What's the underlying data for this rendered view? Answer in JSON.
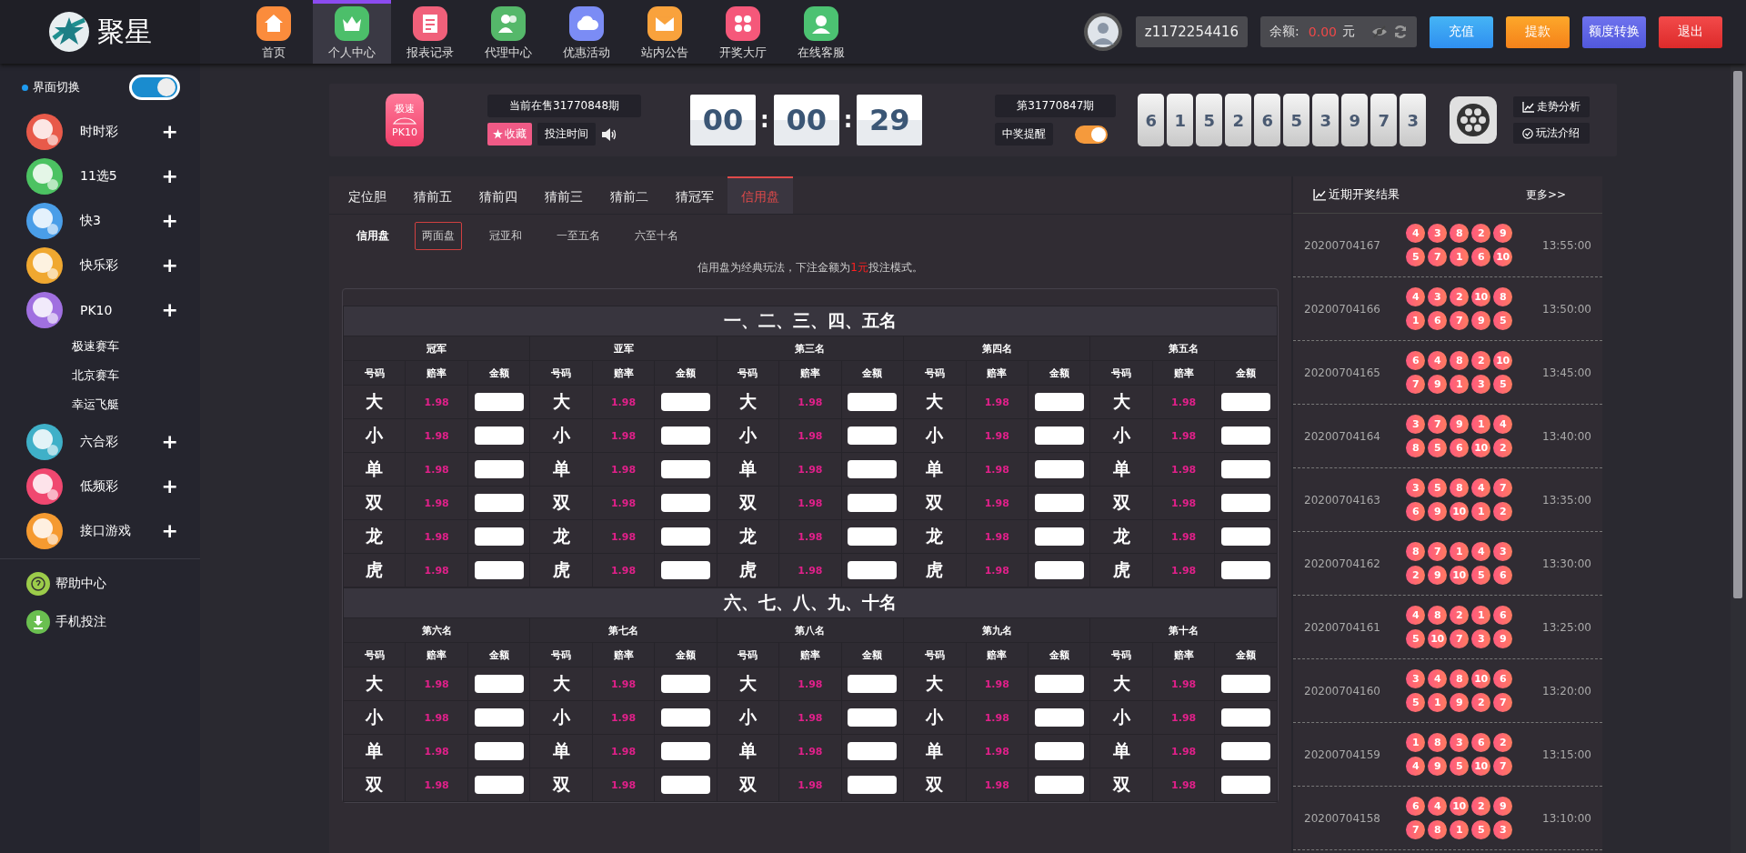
{
  "brand": {
    "name": "聚星"
  },
  "nav": [
    {
      "label": "首页",
      "kind": "home",
      "color": "#fb8c3c",
      "selected": false
    },
    {
      "label": "个人中心",
      "kind": "crown",
      "color": "#4cbf6a",
      "selected": true
    },
    {
      "label": "报表记录",
      "kind": "doc",
      "color": "#f0607a",
      "selected": false
    },
    {
      "label": "代理中心",
      "kind": "people",
      "color": "#55b86a",
      "selected": false
    },
    {
      "label": "优惠活动",
      "kind": "cloud",
      "color": "#7b8cf5",
      "selected": false
    },
    {
      "label": "站内公告",
      "kind": "mail",
      "color": "#f9a23c",
      "selected": false
    },
    {
      "label": "开奖大厅",
      "kind": "grid",
      "color": "#f5587a",
      "selected": false
    },
    {
      "label": "在线客服",
      "kind": "support",
      "color": "#4cc272",
      "selected": false
    }
  ],
  "user": {
    "username": "z1172254416",
    "balance_label": "余额:",
    "balance": "0.00",
    "currency": "元"
  },
  "actions": [
    {
      "label": "充值",
      "kind": "blue"
    },
    {
      "label": "提款",
      "kind": "orange"
    },
    {
      "label": "额度转换",
      "kind": "purple"
    },
    {
      "label": "退出",
      "kind": "red"
    }
  ],
  "sidebar": {
    "switch": {
      "label": "界面切换",
      "on": true
    },
    "categories": [
      {
        "label": "时时彩",
        "color": "#e85a4a",
        "sign": "+"
      },
      {
        "label": "11选5",
        "color": "#4cc262",
        "sign": "+"
      },
      {
        "label": "快3",
        "color": "#4a9ee8",
        "sign": "+"
      },
      {
        "label": "快乐彩",
        "color": "#f0a830",
        "sign": "+"
      },
      {
        "label": "PK10",
        "color": "#a070e0",
        "sign": "+",
        "children": [
          {
            "label": "极速赛车"
          },
          {
            "label": "北京赛车"
          },
          {
            "label": "幸运飞艇"
          }
        ]
      },
      {
        "label": "六合彩",
        "color": "#3fb0c8",
        "sign": "+"
      },
      {
        "label": "低频彩",
        "color": "#f04870",
        "sign": "+"
      },
      {
        "label": "接口游戏",
        "color": "#f59a30",
        "sign": "+"
      }
    ],
    "links": [
      {
        "label": "帮助中心",
        "kind": "help"
      },
      {
        "label": "手机投注",
        "kind": "download"
      }
    ]
  },
  "game": {
    "logo_top": "极速",
    "logo_bottom": "PK10",
    "current_issue": "当前在售31770848期",
    "favorite": "收藏",
    "bet_time": "投注时间",
    "timer": [
      "00",
      "00",
      "29"
    ],
    "separator": ":",
    "last_issue": "第31770847期",
    "win_alert": {
      "label": "中奖提醒",
      "on": true
    },
    "numbers": [
      "6",
      "1",
      "5",
      "2",
      "6",
      "5",
      "3",
      "9",
      "7",
      "3"
    ],
    "links": [
      "走势分析",
      "玩法介绍"
    ]
  },
  "tabs": [
    {
      "label": "定位胆",
      "selected": false
    },
    {
      "label": "猜前五",
      "selected": false
    },
    {
      "label": "猜前四",
      "selected": false
    },
    {
      "label": "猜前三",
      "selected": false
    },
    {
      "label": "猜前二",
      "selected": false
    },
    {
      "label": "猜冠军",
      "selected": false
    },
    {
      "label": "信用盘",
      "selected": true
    }
  ],
  "subtabs": {
    "title": "信用盘",
    "items": [
      {
        "label": "两面盘",
        "selected": true
      },
      {
        "label": "冠亚和",
        "selected": false
      },
      {
        "label": "一至五名",
        "selected": false
      },
      {
        "label": "六至十名",
        "selected": false
      }
    ]
  },
  "notice": {
    "before": "信用盘为经典玩法，下注金额为",
    "highlight": "1元",
    "after": "投注模式。"
  },
  "sections": [
    {
      "title": "一、二、三、四、五名",
      "groups": [
        {
          "name": "冠军",
          "columns": [
            "号码",
            "赔率",
            "金额"
          ],
          "rows": [
            {
              "label": "大",
              "odds": "1.98"
            },
            {
              "label": "小",
              "odds": "1.98"
            },
            {
              "label": "单",
              "odds": "1.98"
            },
            {
              "label": "双",
              "odds": "1.98"
            },
            {
              "label": "龙",
              "odds": "1.98"
            },
            {
              "label": "虎",
              "odds": "1.98"
            }
          ]
        },
        {
          "name": "亚军",
          "columns": [
            "号码",
            "赔率",
            "金额"
          ],
          "rows": [
            {
              "label": "大",
              "odds": "1.98"
            },
            {
              "label": "小",
              "odds": "1.98"
            },
            {
              "label": "单",
              "odds": "1.98"
            },
            {
              "label": "双",
              "odds": "1.98"
            },
            {
              "label": "龙",
              "odds": "1.98"
            },
            {
              "label": "虎",
              "odds": "1.98"
            }
          ]
        },
        {
          "name": "第三名",
          "columns": [
            "号码",
            "赔率",
            "金额"
          ],
          "rows": [
            {
              "label": "大",
              "odds": "1.98"
            },
            {
              "label": "小",
              "odds": "1.98"
            },
            {
              "label": "单",
              "odds": "1.98"
            },
            {
              "label": "双",
              "odds": "1.98"
            },
            {
              "label": "龙",
              "odds": "1.98"
            },
            {
              "label": "虎",
              "odds": "1.98"
            }
          ]
        },
        {
          "name": "第四名",
          "columns": [
            "号码",
            "赔率",
            "金额"
          ],
          "rows": [
            {
              "label": "大",
              "odds": "1.98"
            },
            {
              "label": "小",
              "odds": "1.98"
            },
            {
              "label": "单",
              "odds": "1.98"
            },
            {
              "label": "双",
              "odds": "1.98"
            },
            {
              "label": "龙",
              "odds": "1.98"
            },
            {
              "label": "虎",
              "odds": "1.98"
            }
          ]
        },
        {
          "name": "第五名",
          "columns": [
            "号码",
            "赔率",
            "金额"
          ],
          "rows": [
            {
              "label": "大",
              "odds": "1.98"
            },
            {
              "label": "小",
              "odds": "1.98"
            },
            {
              "label": "单",
              "odds": "1.98"
            },
            {
              "label": "双",
              "odds": "1.98"
            },
            {
              "label": "龙",
              "odds": "1.98"
            },
            {
              "label": "虎",
              "odds": "1.98"
            }
          ]
        }
      ]
    },
    {
      "title": "六、七、八、九、十名",
      "groups": [
        {
          "name": "第六名",
          "columns": [
            "号码",
            "赔率",
            "金额"
          ],
          "rows": [
            {
              "label": "大",
              "odds": "1.98"
            },
            {
              "label": "小",
              "odds": "1.98"
            },
            {
              "label": "单",
              "odds": "1.98"
            },
            {
              "label": "双",
              "odds": "1.98"
            }
          ]
        },
        {
          "name": "第七名",
          "columns": [
            "号码",
            "赔率",
            "金额"
          ],
          "rows": [
            {
              "label": "大",
              "odds": "1.98"
            },
            {
              "label": "小",
              "odds": "1.98"
            },
            {
              "label": "单",
              "odds": "1.98"
            },
            {
              "label": "双",
              "odds": "1.98"
            }
          ]
        },
        {
          "name": "第八名",
          "columns": [
            "号码",
            "赔率",
            "金额"
          ],
          "rows": [
            {
              "label": "大",
              "odds": "1.98"
            },
            {
              "label": "小",
              "odds": "1.98"
            },
            {
              "label": "单",
              "odds": "1.98"
            },
            {
              "label": "双",
              "odds": "1.98"
            }
          ]
        },
        {
          "name": "第九名",
          "columns": [
            "号码",
            "赔率",
            "金额"
          ],
          "rows": [
            {
              "label": "大",
              "odds": "1.98"
            },
            {
              "label": "小",
              "odds": "1.98"
            },
            {
              "label": "单",
              "odds": "1.98"
            },
            {
              "label": "双",
              "odds": "1.98"
            }
          ]
        },
        {
          "name": "第十名",
          "columns": [
            "号码",
            "赔率",
            "金额"
          ],
          "rows": [
            {
              "label": "大",
              "odds": "1.98"
            },
            {
              "label": "小",
              "odds": "1.98"
            },
            {
              "label": "单",
              "odds": "1.98"
            },
            {
              "label": "双",
              "odds": "1.98"
            }
          ]
        }
      ]
    }
  ],
  "results": {
    "title": "近期开奖结果",
    "more": "更多>>",
    "rows": [
      {
        "issue": "20200704167",
        "balls": [
          "4",
          "3",
          "8",
          "2",
          "9",
          "5",
          "7",
          "1",
          "6",
          "10"
        ],
        "time": "13:55:00"
      },
      {
        "issue": "20200704166",
        "balls": [
          "4",
          "3",
          "2",
          "10",
          "8",
          "1",
          "6",
          "7",
          "9",
          "5"
        ],
        "time": "13:50:00"
      },
      {
        "issue": "20200704165",
        "balls": [
          "6",
          "4",
          "8",
          "2",
          "10",
          "7",
          "9",
          "1",
          "3",
          "5"
        ],
        "time": "13:45:00"
      },
      {
        "issue": "20200704164",
        "balls": [
          "3",
          "7",
          "9",
          "1",
          "4",
          "8",
          "5",
          "6",
          "10",
          "2"
        ],
        "time": "13:40:00"
      },
      {
        "issue": "20200704163",
        "balls": [
          "3",
          "5",
          "8",
          "4",
          "7",
          "6",
          "9",
          "10",
          "1",
          "2"
        ],
        "time": "13:35:00"
      },
      {
        "issue": "20200704162",
        "balls": [
          "8",
          "7",
          "1",
          "4",
          "3",
          "2",
          "9",
          "10",
          "5",
          "6"
        ],
        "time": "13:30:00"
      },
      {
        "issue": "20200704161",
        "balls": [
          "4",
          "8",
          "2",
          "1",
          "6",
          "5",
          "10",
          "7",
          "3",
          "9"
        ],
        "time": "13:25:00"
      },
      {
        "issue": "20200704160",
        "balls": [
          "3",
          "4",
          "8",
          "10",
          "6",
          "5",
          "1",
          "9",
          "2",
          "7"
        ],
        "time": "13:20:00"
      },
      {
        "issue": "20200704159",
        "balls": [
          "1",
          "8",
          "3",
          "6",
          "2",
          "4",
          "9",
          "5",
          "10",
          "7"
        ],
        "time": "13:15:00"
      },
      {
        "issue": "20200704158",
        "balls": [
          "6",
          "4",
          "10",
          "2",
          "9",
          "7",
          "8",
          "1",
          "5",
          "3"
        ],
        "time": "13:10:00"
      }
    ]
  }
}
